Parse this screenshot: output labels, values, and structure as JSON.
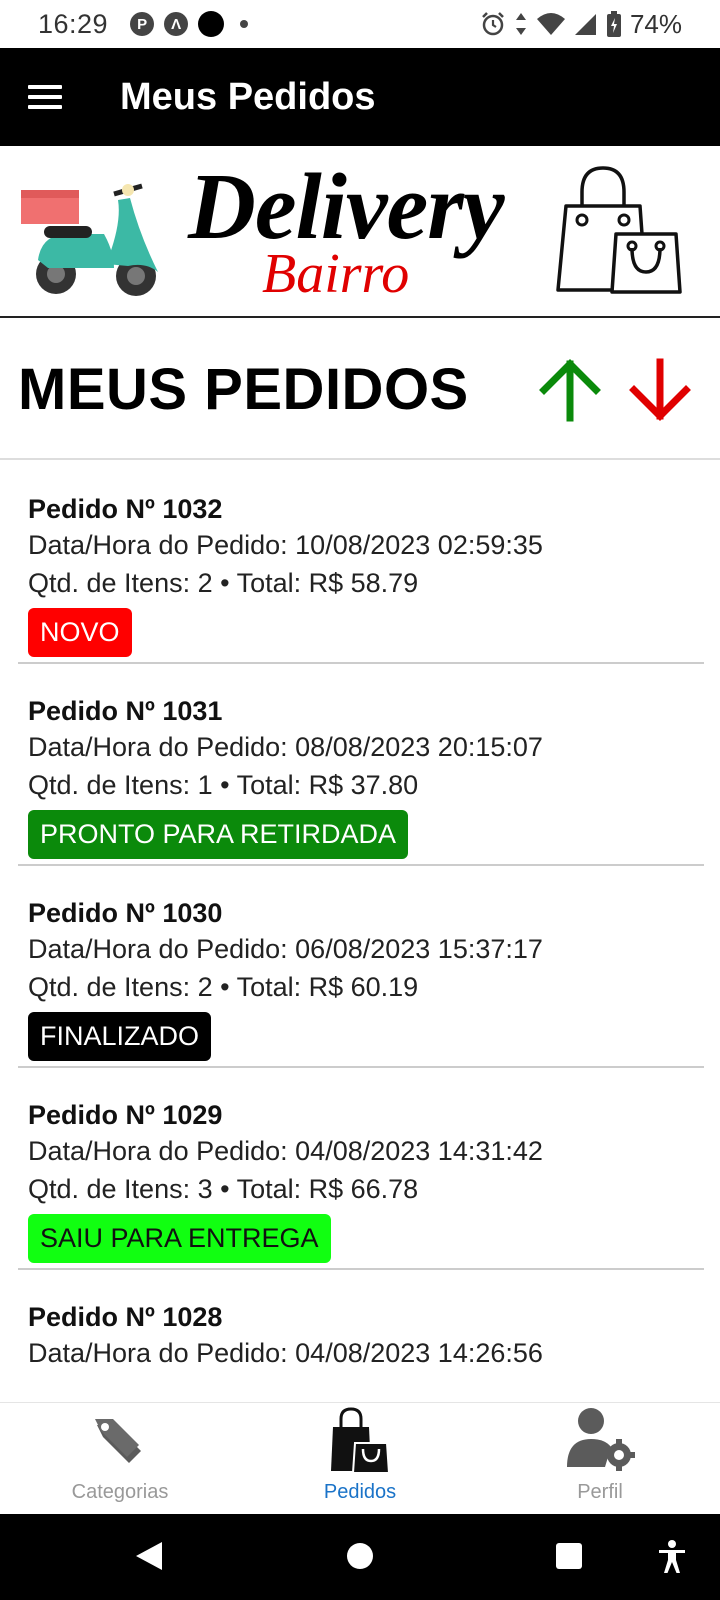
{
  "status_bar": {
    "time": "16:29",
    "battery": "74%"
  },
  "app_bar": {
    "title": "Meus Pedidos"
  },
  "banner": {
    "logo_line1": "Delivery",
    "logo_line2": "Bairro"
  },
  "section": {
    "title": "MEUS PEDIDOS"
  },
  "colors": {
    "sort_up": "#0a8a0a",
    "sort_down": "#e00000",
    "active_nav": "#1a73c8"
  },
  "orders": [
    {
      "title": "Pedido Nº 1032",
      "datetime": "Data/Hora do Pedido: 10/08/2023 02:59:35",
      "summary": "Qtd. de Itens: 2 • Total: R$ 58.79",
      "status": "NOVO",
      "status_color": "#ff0000",
      "status_text_color": "#ffffff"
    },
    {
      "title": "Pedido Nº 1031",
      "datetime": "Data/Hora do Pedido: 08/08/2023 20:15:07",
      "summary": "Qtd. de Itens: 1 • Total: R$ 37.80",
      "status": "PRONTO PARA RETIRDADA",
      "status_color": "#0b8a0b",
      "status_text_color": "#ffffff"
    },
    {
      "title": "Pedido Nº 1030",
      "datetime": "Data/Hora do Pedido: 06/08/2023 15:37:17",
      "summary": "Qtd. de Itens: 2 • Total: R$ 60.19",
      "status": "FINALIZADO",
      "status_color": "#000000",
      "status_text_color": "#ffffff"
    },
    {
      "title": "Pedido Nº 1029",
      "datetime": "Data/Hora do Pedido: 04/08/2023 14:31:42",
      "summary": "Qtd. de Itens: 3 • Total: R$ 66.78",
      "status": "SAIU PARA ENTREGA",
      "status_color": "#11ff11",
      "status_text_color": "#111111"
    },
    {
      "title": "Pedido Nº 1028",
      "datetime": "Data/Hora do Pedido: 04/08/2023 14:26:56",
      "summary": "",
      "status": "",
      "status_color": "",
      "status_text_color": ""
    }
  ],
  "bottom_nav": {
    "items": [
      {
        "label": "Categorias",
        "icon": "tags-icon"
      },
      {
        "label": "Pedidos",
        "icon": "shopping-bags-icon"
      },
      {
        "label": "Perfil",
        "icon": "user-settings-icon"
      }
    ]
  }
}
